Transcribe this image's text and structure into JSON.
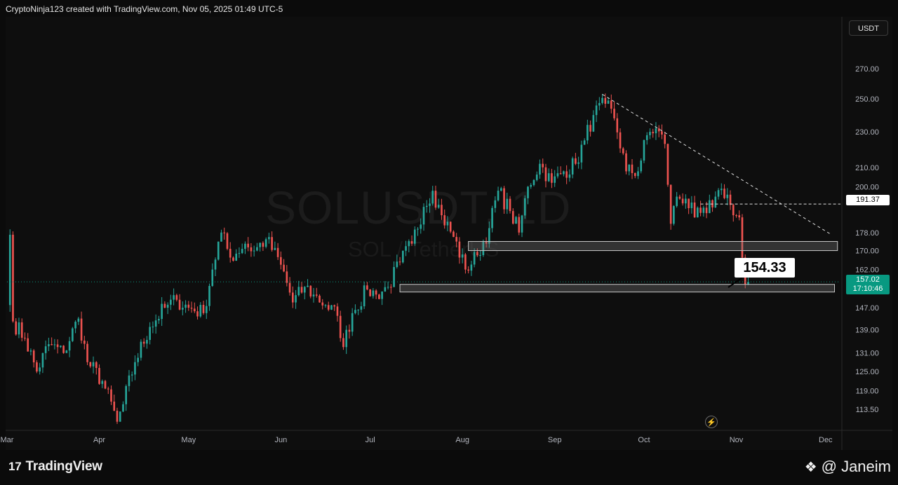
{
  "header": {
    "attribution": "CryptoNinja123 created with TradingView.com, Nov 05, 2025 01:49 UTC-5"
  },
  "watermark": {
    "symbol": "SOLUSDT, 1D",
    "name": "SOL / TetherUS"
  },
  "currency_button": "USDT",
  "footer": {
    "brand": "TradingView",
    "brand_mark": "17",
    "author": "@ Janeim"
  },
  "callout_label": "154.33",
  "price_tags": {
    "level": "191.37",
    "current_price": "157.02",
    "countdown": "17:10:46"
  },
  "icons": {
    "replay": "flash-icon",
    "binance": "binance-diamond-icon",
    "logo": "tradingview-logo-icon"
  },
  "colors": {
    "up": "#26a69a",
    "down": "#ef5350",
    "zone": "#c8c8c8",
    "current": "#089981"
  },
  "chart_data": {
    "type": "candlestick",
    "symbol": "SOLUSDT",
    "interval": "1D",
    "y_scale": "log",
    "ylim": [
      108,
      290
    ],
    "xlim": [
      "2025-03-01",
      "2025-12-06"
    ],
    "y_ticks": [
      "270.00",
      "250.00",
      "230.00",
      "210.00",
      "200.00",
      "178.00",
      "170.00",
      "162.00",
      "147.00",
      "139.00",
      "131.00",
      "125.00",
      "119.00",
      "113.50"
    ],
    "x_ticks": [
      {
        "label": "Mar",
        "date": "2025-03-01"
      },
      {
        "label": "Apr",
        "date": "2025-04-01"
      },
      {
        "label": "May",
        "date": "2025-05-01"
      },
      {
        "label": "Jun",
        "date": "2025-06-01"
      },
      {
        "label": "Jul",
        "date": "2025-07-01"
      },
      {
        "label": "Aug",
        "date": "2025-08-01"
      },
      {
        "label": "Sep",
        "date": "2025-09-01"
      },
      {
        "label": "Oct",
        "date": "2025-10-01"
      },
      {
        "label": "Nov",
        "date": "2025-11-01"
      },
      {
        "label": "Dec",
        "date": "2025-12-01"
      }
    ],
    "close_anchors": [
      [
        "2025-03-01",
        148
      ],
      [
        "2025-03-02",
        177
      ],
      [
        "2025-03-03",
        142
      ],
      [
        "2025-03-07",
        136
      ],
      [
        "2025-03-11",
        125
      ],
      [
        "2025-03-15",
        134
      ],
      [
        "2025-03-20",
        131
      ],
      [
        "2025-03-25",
        143
      ],
      [
        "2025-03-28",
        128
      ],
      [
        "2025-04-02",
        122
      ],
      [
        "2025-04-07",
        110
      ],
      [
        "2025-04-09",
        115
      ],
      [
        "2025-04-13",
        128
      ],
      [
        "2025-04-18",
        140
      ],
      [
        "2025-04-23",
        147
      ],
      [
        "2025-04-27",
        150
      ],
      [
        "2025-05-01",
        147
      ],
      [
        "2025-05-06",
        145
      ],
      [
        "2025-05-09",
        162
      ],
      [
        "2025-05-12",
        178
      ],
      [
        "2025-05-15",
        167
      ],
      [
        "2025-05-20",
        173
      ],
      [
        "2025-05-23",
        170
      ],
      [
        "2025-05-27",
        175
      ],
      [
        "2025-06-01",
        164
      ],
      [
        "2025-06-05",
        149
      ],
      [
        "2025-06-09",
        155
      ],
      [
        "2025-06-12",
        152
      ],
      [
        "2025-06-16",
        148
      ],
      [
        "2025-06-20",
        144
      ],
      [
        "2025-06-22",
        133
      ],
      [
        "2025-06-25",
        145
      ],
      [
        "2025-06-30",
        154
      ],
      [
        "2025-07-03",
        152
      ],
      [
        "2025-07-07",
        155
      ],
      [
        "2025-07-11",
        165
      ],
      [
        "2025-07-15",
        173
      ],
      [
        "2025-07-19",
        190
      ],
      [
        "2025-07-22",
        198
      ],
      [
        "2025-07-25",
        186
      ],
      [
        "2025-07-29",
        176
      ],
      [
        "2025-08-02",
        162
      ],
      [
        "2025-08-06",
        168
      ],
      [
        "2025-08-10",
        180
      ],
      [
        "2025-08-13",
        198
      ],
      [
        "2025-08-17",
        188
      ],
      [
        "2025-08-20",
        178
      ],
      [
        "2025-08-23",
        200
      ],
      [
        "2025-08-27",
        212
      ],
      [
        "2025-08-31",
        202
      ],
      [
        "2025-09-04",
        208
      ],
      [
        "2025-09-08",
        212
      ],
      [
        "2025-09-11",
        225
      ],
      [
        "2025-09-14",
        240
      ],
      [
        "2025-09-18",
        247
      ],
      [
        "2025-09-21",
        238
      ],
      [
        "2025-09-25",
        208
      ],
      [
        "2025-09-29",
        208
      ],
      [
        "2025-10-02",
        228
      ],
      [
        "2025-10-05",
        232
      ],
      [
        "2025-10-08",
        223
      ],
      [
        "2025-10-10",
        182
      ],
      [
        "2025-10-12",
        195
      ],
      [
        "2025-10-15",
        194
      ],
      [
        "2025-10-18",
        185
      ],
      [
        "2025-10-22",
        187
      ],
      [
        "2025-10-25",
        195
      ],
      [
        "2025-10-27",
        199
      ],
      [
        "2025-10-29",
        196
      ],
      [
        "2025-10-31",
        186
      ],
      [
        "2025-11-02",
        185
      ],
      [
        "2025-11-03",
        167
      ],
      [
        "2025-11-04",
        156
      ],
      [
        "2025-11-05",
        157
      ]
    ],
    "resistance_trendline": {
      "from": [
        "2025-09-17",
        253
      ],
      "to": [
        "2025-12-03",
        177
      ]
    },
    "levels": [
      {
        "label": "191.37",
        "value": 191.37,
        "from": "2025-10-20"
      }
    ],
    "support_zones": [
      {
        "from": "2025-08-03",
        "to": "2025-12-05",
        "low": 170,
        "high": 174
      },
      {
        "from": "2025-07-11",
        "to": "2025-12-04",
        "low": 153,
        "high": 156
      }
    ],
    "current_price": 157.02
  }
}
